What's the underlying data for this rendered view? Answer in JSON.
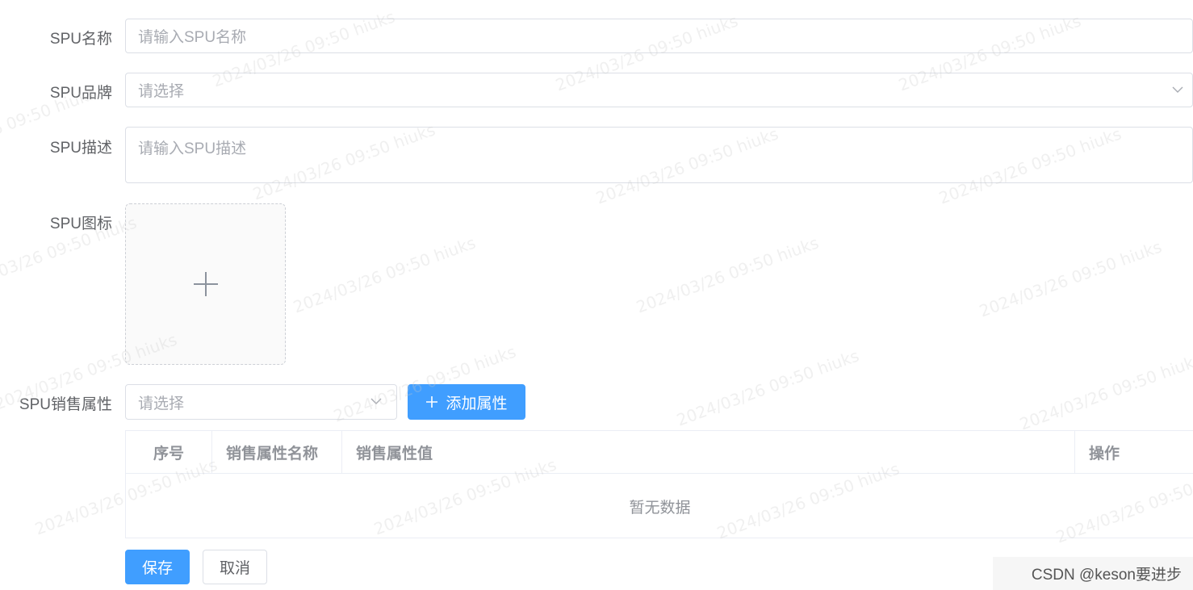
{
  "form": {
    "name_label": "SPU名称",
    "name_placeholder": "请输入SPU名称",
    "brand_label": "SPU品牌",
    "brand_placeholder": "请选择",
    "desc_label": "SPU描述",
    "desc_placeholder": "请输入SPU描述",
    "icon_label": "SPU图标",
    "sale_attr_label": "SPU销售属性",
    "sale_attr_placeholder": "请选择",
    "add_attr_button": "添加属性"
  },
  "table": {
    "columns": [
      "序号",
      "销售属性名称",
      "销售属性值",
      "操作"
    ],
    "empty_text": "暂无数据"
  },
  "actions": {
    "save": "保存",
    "cancel": "取消"
  },
  "watermark": "2024/03/26 09:50 hiuks",
  "credit": "CSDN @keson要进步",
  "colors": {
    "primary": "#409eff",
    "border": "#dcdfe6",
    "placeholder": "#a8abb2",
    "label": "#606266",
    "table_header": "#909399"
  },
  "icons": [
    "plus-icon",
    "chevron-down-icon"
  ]
}
